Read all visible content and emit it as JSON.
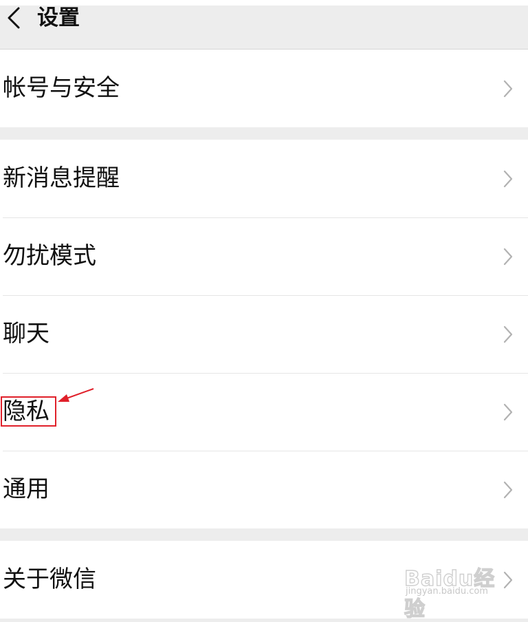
{
  "header": {
    "back_icon": "chevron-left-icon",
    "title": "设置"
  },
  "groups": [
    {
      "items": [
        {
          "label": "帐号与安全"
        }
      ]
    },
    {
      "items": [
        {
          "label": "新消息提醒"
        },
        {
          "label": "勿扰模式"
        },
        {
          "label": "聊天"
        },
        {
          "label": "隐私"
        },
        {
          "label": "通用"
        }
      ]
    },
    {
      "items": [
        {
          "label": "关于微信"
        }
      ]
    }
  ],
  "annotation": {
    "target": "隐私",
    "color": "#e0202a"
  },
  "watermark": {
    "logo": "Baidu经验",
    "url": "jingyan.baidu.com"
  }
}
